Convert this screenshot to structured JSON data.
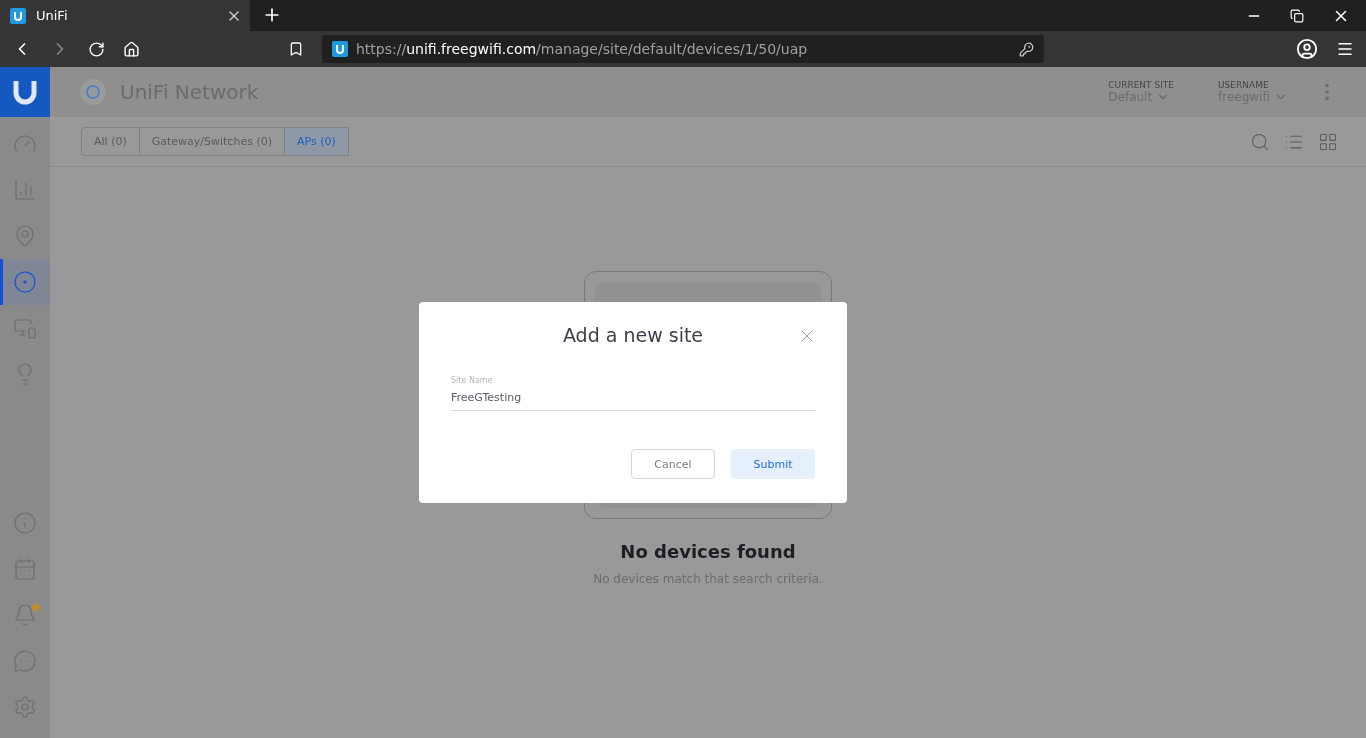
{
  "browser": {
    "tab_title": "UniFi",
    "url_scheme": "https://",
    "url_host": "unifi.freegwifi.com",
    "url_path": "/manage/site/default/devices/1/50/uap"
  },
  "app": {
    "brand": "UniFi Network",
    "current_site": {
      "label": "CURRENT SITE",
      "value": "Default"
    },
    "username": {
      "label": "USERNAME",
      "value": "freegwifi"
    }
  },
  "sidebar": {
    "top": [
      {
        "kind": "dashboard",
        "selected": false
      },
      {
        "kind": "statistics",
        "selected": false
      },
      {
        "kind": "map",
        "selected": false
      },
      {
        "kind": "devices",
        "selected": true
      },
      {
        "kind": "clients",
        "selected": false
      },
      {
        "kind": "insights",
        "selected": false
      }
    ],
    "bottom": [
      {
        "kind": "info",
        "selected": false,
        "badge": false
      },
      {
        "kind": "events",
        "selected": false,
        "badge": false
      },
      {
        "kind": "alerts",
        "selected": false,
        "badge": true
      },
      {
        "kind": "chat",
        "selected": false,
        "badge": false
      },
      {
        "kind": "settings",
        "selected": false,
        "badge": false
      }
    ]
  },
  "filter_tabs": [
    {
      "label": "All (0)",
      "selected": false
    },
    {
      "label": "Gateway/Switches (0)",
      "selected": false
    },
    {
      "label": "APs (0)",
      "selected": true
    }
  ],
  "empty_state": {
    "title": "No devices found",
    "subtitle": "No devices match that search criteria."
  },
  "dialog": {
    "title": "Add a new site",
    "field_label": "Site Name",
    "field_value": "FreeGTesting",
    "buttons": [
      {
        "label": "Cancel",
        "kind": "secondary"
      },
      {
        "label": "Submit",
        "kind": "primary"
      }
    ]
  }
}
